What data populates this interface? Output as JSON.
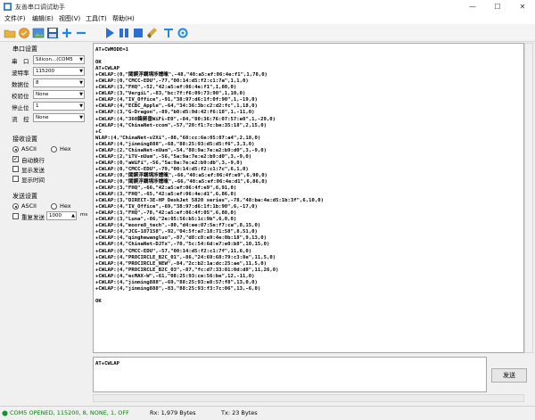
{
  "window": {
    "title": "友善串口调试助手",
    "minimize_glyph": "—",
    "maximize_glyph": "☐",
    "close_glyph": "✕"
  },
  "menu": {
    "items": [
      "文件(F)",
      "编辑(E)",
      "视图(V)",
      "工具(T)",
      "帮助(H)"
    ]
  },
  "toolbar": {
    "icons": [
      "open-folder-icon",
      "save-icon",
      "picture-icon",
      "save-log-icon",
      "add-icon",
      "remove-icon",
      "play-icon",
      "pause-icon",
      "stop-icon",
      "clear-icon",
      "text-icon",
      "settings-icon"
    ]
  },
  "serial_settings": {
    "title": "串口设置",
    "port_label": "串　口",
    "port_value": "Silicon...(COM5",
    "baud_label": "波特率",
    "baud_value": "115200",
    "databits_label": "数据位",
    "databits_value": "8",
    "parity_label": "校验位",
    "parity_value": "None",
    "stopbits_label": "停止位",
    "stopbits_value": "1",
    "flow_label": "流　控",
    "flow_value": "None"
  },
  "receive_settings": {
    "title": "接收设置",
    "ascii_label": "ASCII",
    "hex_label": "Hex",
    "auto_newline_label": "自动换行",
    "show_send_label": "显示发送",
    "show_time_label": "显示时间"
  },
  "send_settings": {
    "title": "发送设置",
    "ascii_label": "ASCII",
    "hex_label": "Hex",
    "repeat_label": "重复发送",
    "repeat_value": "1000",
    "repeat_unit": "ms"
  },
  "terminal": {
    "lines": [
      "AT+CWMODE=1",
      "",
      "OK",
      "AT+CWLAP",
      "+CWLAP:(0,\"閣鍥浮鐗堣埗嬬暣\",-48,\"40:a5:ef:06:4e:f1\",1,78,0)",
      "+CWLAP:(0,\"CMCC-EDU\",-77,\"00:14:d5:f2:c1:7a\",1,1,0)",
      "+CWLAP:(3,\"FHQ\",-52,\"42:a5:ef:06:4e:f1\",1,80,0)",
      "+CWLAP:(3,\"VergiL\",-83,\"bc:7f:f6:09:73:90\",1,10,0)",
      "+CWLAP:(4,\"IV_Office\",-91,\"38:97:d6:1f:0f:90\",1,-19,0)",
      "+CWLAP:(4,\"ECBC_Apple\",-64,\"34:36:3b:c2:d2:fc\",1,18,0)",
      "+CWLAP:(3,\"G-Dragon\",-89,\"b0:d5:9d:42:f6:18\",1,-11,0)",
      "+CWLAP:(4,\"360鍏嶈垂WiFi-E0\",-84,\"80:36:76:07:57:e0\",1,-29,0)",
      "+CWLAP:(4,\"ChinaNet-ccom\",-57,\"20:f1:7c:be:35:18\",2,15,0)",
      "+C",
      "WLAP:(4,\"ChinaNet-v2Xi\",-88,\"68:cc:6e:05:07:a4\",2,18,0)",
      "+CWLAP:(4,\"jinming888\",-68,\"88:25:93:d5:d5:f6\",3,3,0)",
      "+CWLAP:(2,\"ChinaNet-nUum\",-54,\"88:9a:7e:e2:b9:d0\",3,-9,0)",
      "+CWLAP:(2,\"iTV-nUum\",-56,\"5a:9a:7e:e2:b9:d0\",3,-9,0)",
      "+CWLAP:(0,\"aWiFi\",-56,\"5a:9a:7e:e2:b9:db\",3,-9,0)",
      "+CWLAP:(0,\"CMCC-EDU\",-79,\"00:14:d5:f2:c1:7c\",6,1,0)",
      "+CWLAP:(0,\"閣鍥浮鐗堣埗嬬暣\",-66,\"40:a5:ef:06:4f:e9\",6,90,0)",
      "+CWLAP:(0,\"閣鍥浮鐗堣埗嬬暣\",-66,\"40:a5:ef:06:4e:d1\",6,86,0)",
      "+CWLAP:(3,\"FHQ\",-66,\"42:a5:ef:06:4f:e9\",6,91,0)",
      "+CWLAP:(3,\"FHQ\",-65,\"42:a5:ef:06:4e:d1\",6,86,0)",
      "+CWLAP:(3,\"DIRECT-3E-HP DeskJet 5820 series\",-78,\"48:ba:4e:d5:1b:3f\",6,10,0)",
      "+CWLAP:(4,\"IV_Office\",-69,\"38:97:d6:1f:1b:90\",6,-17,0)",
      "+CWLAP:(3,\"FHQ\",-78,\"42:a5:ef:06:4f:05\",6,88,0)",
      "+CWLAP:(3,\"Luna\",-86,\"2e:05:56:b5:1c:9b\",6,0,0)",
      "+CWLAP:(4,\"moore8_tech\",-80,\"d4:ee:07:5e:f7:ca\",8,15,0)",
      "+CWLAP:(4,\"JCG-187158\",-92,\"04:5f:a7:18:71:58\",8,51,0)",
      "+CWLAP:(4,\"qinghewangluo\",-87,\"d8:c8:e9:4e:0b:18\",9,13,0)",
      "+CWLAP:(4,\"ChinaNet-DJTx\",-70,\"5c:54:6d:e7:e0:b8\",10,15,0)",
      "+CWLAP:(0,\"CMCC-EDU\",-57,\"00:14:d5:f2:c1:7f\",11,6,0)",
      "+CWLAP:(4,\"PROCIRCLE_B2C_01\",-86,\"24:69:68:79:c3:8e\",11,5,0)",
      "+CWLAP:(4,\"PROCIRCLE_NEW\",-84,\"2c:b2:1a:dc:25:ae\",11,5,0)",
      "+CWLAP:(4,\"PROCIRCLE_B2C_03\",-87,\"fc:d7:33:01:0d:d8\",11,26,0)",
      "+CWLAP:(4,\"ecMAX-W\",-61,\"08:25:93:ce:56:be\",12,-11,0)",
      "+CWLAP:(4,\"jinming888\",-69,\"88:25:93:e8:57:f8\",13,0,0)",
      "+CWLAP:(4,\"jinming888\",-83,\"88:25:93:f3:7c:06\",13,-6,0)",
      "",
      "OK"
    ]
  },
  "send": {
    "input_value": "AT+CWLAP",
    "button_label": "发送"
  },
  "status": {
    "port_status": "COM5 OPENED, 115200, 8, NONE, 1, OFF",
    "rx": "Rx: 1,979 Bytes",
    "tx": "Tx: 23 Bytes"
  },
  "colors": {
    "play_blue": "#2a6fd6",
    "status_text_green": "#0a7a0a",
    "accent_blue": "#1e6fd9"
  }
}
